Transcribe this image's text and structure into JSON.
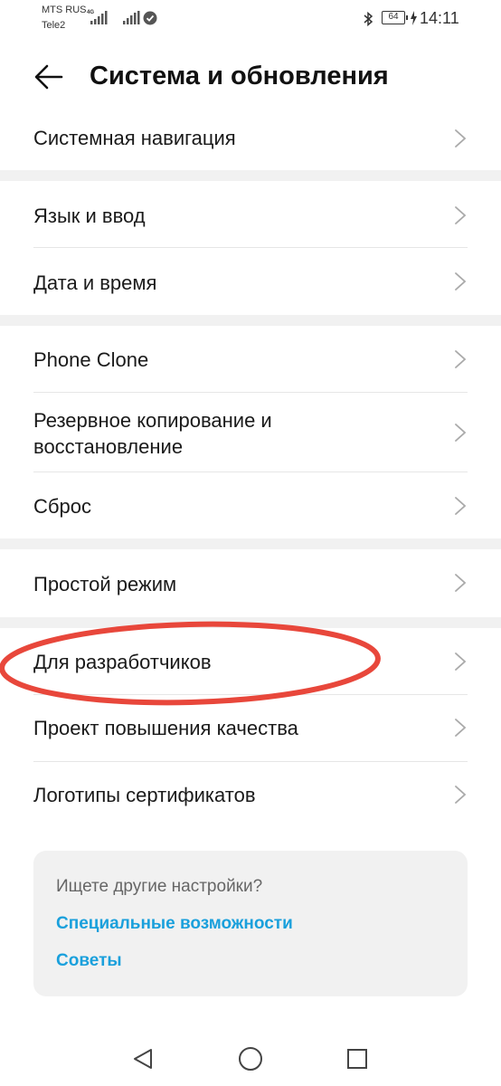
{
  "status_bar": {
    "carrier1": "MTS RUS",
    "carrier2": "Tele2",
    "network": "4G",
    "battery": "64",
    "time": "14:11"
  },
  "header": {
    "title": "Система и обновления"
  },
  "groups": [
    [
      {
        "label": "Системная навигация"
      }
    ],
    [
      {
        "label": "Язык и ввод"
      },
      {
        "label": "Дата и время"
      }
    ],
    [
      {
        "label": "Phone Clone"
      },
      {
        "label": "Резервное копирование и восстановление"
      },
      {
        "label": "Сброс"
      }
    ],
    [
      {
        "label": "Простой режим"
      }
    ],
    [
      {
        "label": "Для разработчиков"
      },
      {
        "label": "Проект повышения качества"
      },
      {
        "label": "Логотипы сертификатов"
      }
    ]
  ],
  "hint": {
    "title": "Ищете другие настройки?",
    "link1": "Специальные возможности",
    "link2": "Советы"
  },
  "colors": {
    "accent": "#1aa0dc",
    "highlight": "#e8473b",
    "separator": "#f1f1f1"
  },
  "icons": [
    "back-arrow-icon",
    "chevron-right-icon",
    "bluetooth-icon",
    "battery-icon",
    "nav-back-icon",
    "nav-home-icon",
    "nav-recent-icon"
  ]
}
